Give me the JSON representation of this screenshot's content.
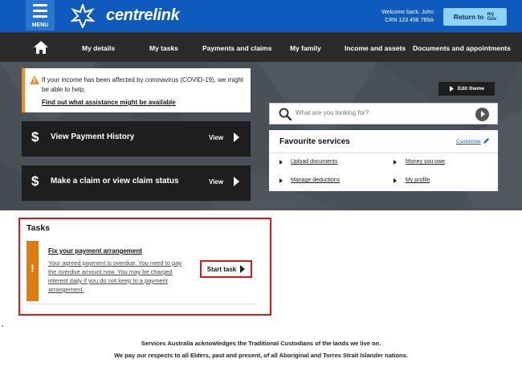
{
  "header": {
    "menu_label": "MENU",
    "logo_text": "centrelink",
    "welcome_line1": "Welcome back, John",
    "welcome_line2": "CRN 123 456 789A",
    "return_label": "Return to",
    "mygov_line1": "my",
    "mygov_line2": "Gov"
  },
  "nav": {
    "items": [
      {
        "label": "My details"
      },
      {
        "label": "My tasks"
      },
      {
        "label": "Payments and claims"
      },
      {
        "label": "My family"
      },
      {
        "label": "Income and assets"
      },
      {
        "label": "Documents and appointments"
      }
    ]
  },
  "alert": {
    "text": "If your income has been affected by coronavirus (COVID-19), we might be able to help.",
    "link": "Find out what assistance might be available"
  },
  "cards": [
    {
      "symbol": "$",
      "title": "View Payment History",
      "action": "View"
    },
    {
      "symbol": "$",
      "title": "Make a claim or view claim status",
      "action": "View"
    }
  ],
  "edit_theme": "Edit theme",
  "search": {
    "placeholder": "What are you looking for?"
  },
  "favourites": {
    "title": "Favourite services",
    "customise": "Customise",
    "items": [
      {
        "label": "Upload documents"
      },
      {
        "label": "Money you owe"
      },
      {
        "label": "Manage deductions"
      },
      {
        "label": "My profile"
      }
    ]
  },
  "tasks": {
    "title": "Tasks",
    "badge": "!",
    "item_title": "Fix your payment arrangement",
    "item_desc": "Your agreed payment is overdue. You need to pay the overdue amount now. You may be charged interest daily if you do not keep to a payment arrangement.",
    "start_label": "Start task"
  },
  "footer": {
    "line1": "Services Australia acknowledges the Traditional Custodians of the lands we live on.",
    "line2": "We pay our respects to all Elders, past and present, of all Aboriginal and Torres Strait Islander nations."
  },
  "colors": {
    "header_blue": "#0e5bbd",
    "nav_dark": "#2b2b2b",
    "alert_orange": "#f28c1e",
    "highlight_red": "#e0141e"
  }
}
